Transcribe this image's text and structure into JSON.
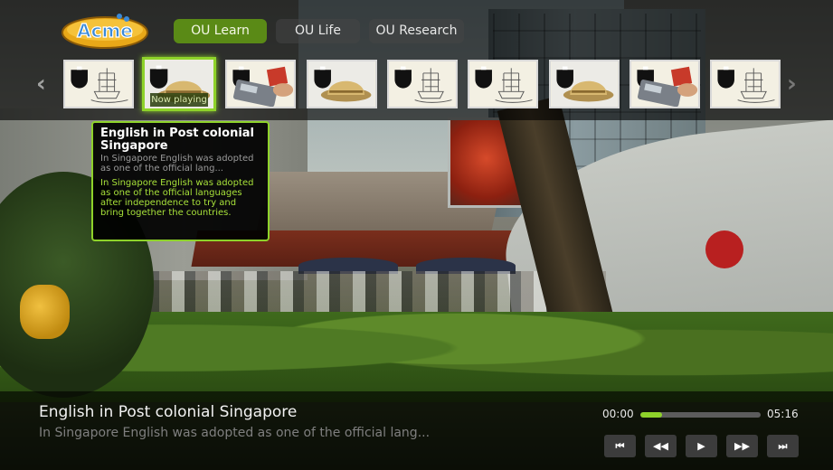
{
  "app": {
    "logo_text": "Acme"
  },
  "tabs": [
    {
      "label": "OU Learn",
      "active": true
    },
    {
      "label": "OU Life",
      "active": false
    },
    {
      "label": "OU Research",
      "active": false
    }
  ],
  "icons": {
    "left_arrow": "‹",
    "right_arrow": "›",
    "previous": "⏮",
    "rewind": "◀◀",
    "play": "▶",
    "fast_forward": "▶▶",
    "next": "⏭"
  },
  "thumbnails": [
    {
      "image": "ou-logo-ship"
    },
    {
      "image": "pith-helmet",
      "now_playing": "Now playing"
    },
    {
      "image": "ou-logo-card-reader"
    },
    {
      "image": "pith-helmet"
    },
    {
      "image": "ou-logo-ship"
    },
    {
      "image": "ou-logo-ship"
    },
    {
      "image": "pith-helmet"
    },
    {
      "image": "ou-logo-card-reader"
    },
    {
      "image": "ou-logo-ship"
    }
  ],
  "tooltip": {
    "title": "English in Post colonial Singapore",
    "subtitle": "In Singapore English was adopted as one of the official lang...",
    "description": "In Singapore English was adopted as one of the official languages after independence to try and bring together the countries."
  },
  "player": {
    "title": "English in Post colonial Singapore",
    "subtitle": "In Singapore English was adopted as one of the official lang...",
    "time_current": "00:00",
    "time_total": "05:16",
    "progress": 0.18
  },
  "colors": {
    "accent": "#8ed22a",
    "tab_active": "#5a8a16",
    "tooltip_desc": "#a8e23a"
  }
}
